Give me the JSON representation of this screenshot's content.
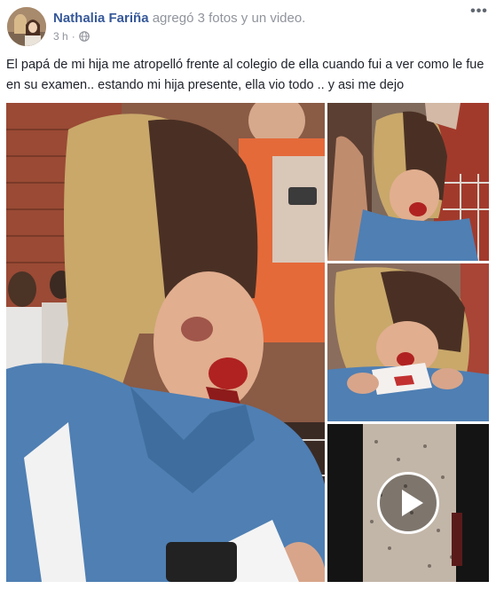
{
  "post": {
    "author": "Nathalia Fariña",
    "action_prefix": "agregó",
    "action_media": "3 fotos y un video.",
    "timestamp": "3 h",
    "separator": "·",
    "privacy_icon": "globe-icon",
    "more_icon": "more-options-icon",
    "more_label": "•••",
    "text": "El papá de mi hija me atropelló frente al colegio de ella cuando fui a ver como le fue en su examen.. estando mi hija presente, ella vio todo .. y asi me dejo",
    "media": {
      "photos_count": 3,
      "videos_count": 1,
      "video_icon": "play-icon"
    }
  },
  "colors": {
    "author_link": "#365899",
    "meta_gray": "#90949c",
    "text": "#1d2129",
    "background": "#ffffff"
  }
}
